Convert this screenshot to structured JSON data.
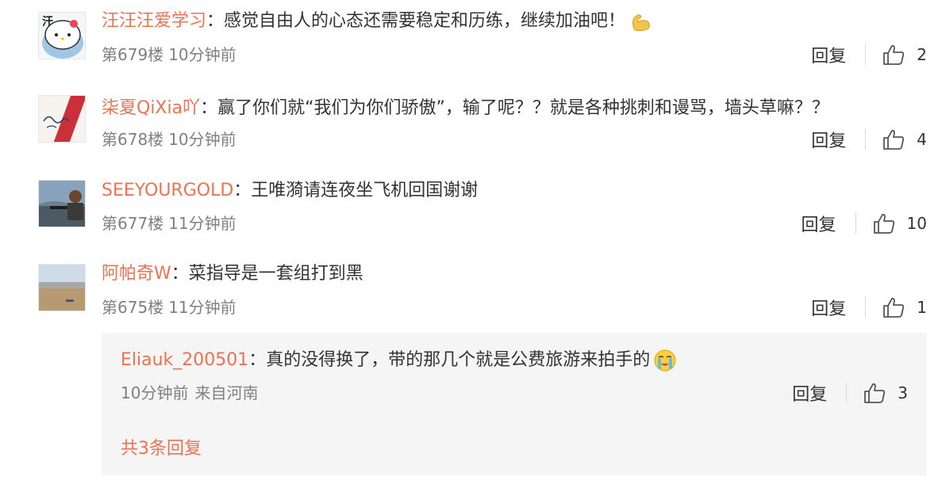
{
  "comments": [
    {
      "username": "汪汪汪爱学习",
      "colon": "：",
      "text": "感觉自由人的心态还需要稳定和历练，继续加油吧！",
      "emoji": "flexed-biceps",
      "floor": "第679楼",
      "time": "10分钟前",
      "reply_label": "回复",
      "likes": "2",
      "avatar": "hello-kitty-avatar"
    },
    {
      "username": "柒夏QiXia吖",
      "colon": "：",
      "text": "赢了你们就“我们为你们骄傲”，输了呢？？就是各种挑刺和谩骂，墙头草嘛？？",
      "floor": "第678楼",
      "time": "10分钟前",
      "reply_label": "回复",
      "likes": "4",
      "avatar": "handwriting-avatar"
    },
    {
      "username": "SEEYOURGOLD",
      "colon": "：",
      "text": "王唯漪请连夜坐飞机回国谢谢",
      "floor": "第677楼",
      "time": "11分钟前",
      "reply_label": "回复",
      "likes": "10",
      "avatar": "person-photo-avatar"
    },
    {
      "username": "阿帕奇W",
      "colon": "：",
      "text": "菜指导是一套组打到黑",
      "floor": "第675楼",
      "time": "11分钟前",
      "reply_label": "回复",
      "likes": "1",
      "avatar": "landscape-avatar"
    }
  ],
  "sub_reply": {
    "username": "Eliauk_200501",
    "colon": "：",
    "text": "真的没得换了，带的那几个就是公费旅游来拍手的",
    "emoji": "crying-face",
    "time": "10分钟前",
    "location": "来自河南",
    "reply_label": "回复",
    "likes": "3",
    "more_replies": "共3条回复"
  },
  "colors": {
    "username": "#eb7350",
    "text": "#333333",
    "meta": "#808080",
    "sub_background": "#f5f5f5"
  }
}
